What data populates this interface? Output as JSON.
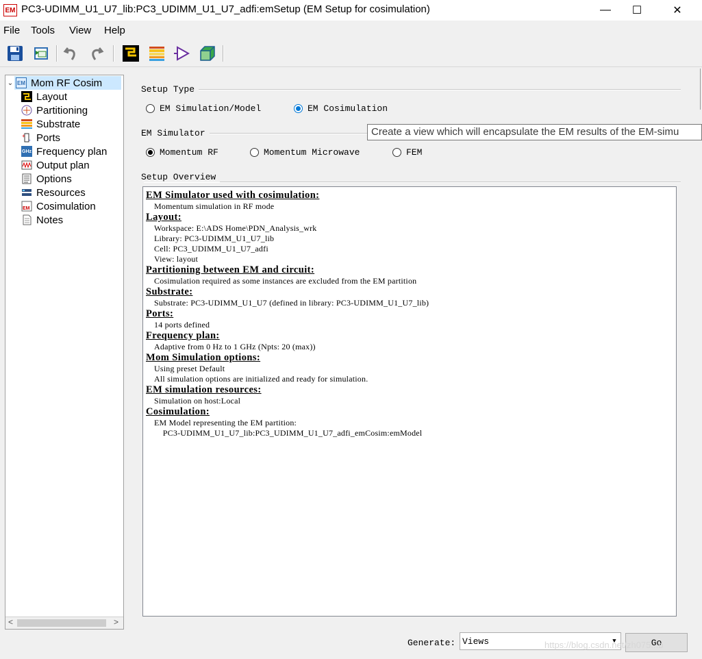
{
  "window": {
    "app_icon_text": "EM",
    "title": "PC3-UDIMM_U1_U7_lib:PC3_UDIMM_U1_U7_adfi:emSetup (EM Setup for cosimulation)",
    "minimize": "—",
    "maximize": "☐",
    "close": "✕"
  },
  "menu": [
    "File",
    "Tools",
    "View",
    "Help"
  ],
  "toolbar": {
    "buttons": [
      "save-icon",
      "em-import-icon",
      "undo-icon",
      "redo-icon",
      "layout-icon",
      "substrate-icon",
      "simulate-icon",
      "3d-view-icon"
    ]
  },
  "tree": {
    "root": "Mom RF Cosim",
    "root_icon_text": "EM",
    "items": [
      {
        "label": "Layout",
        "icon": "layout-icon"
      },
      {
        "label": "Partitioning",
        "icon": "partitioning-icon"
      },
      {
        "label": "Substrate",
        "icon": "substrate-icon"
      },
      {
        "label": "Ports",
        "icon": "ports-icon"
      },
      {
        "label": "Frequency plan",
        "icon": "frequency-icon"
      },
      {
        "label": "Output plan",
        "icon": "output-icon"
      },
      {
        "label": "Options",
        "icon": "options-icon"
      },
      {
        "label": "Resources",
        "icon": "resources-icon"
      },
      {
        "label": "Cosimulation",
        "icon": "cosimulation-icon"
      },
      {
        "label": "Notes",
        "icon": "notes-icon"
      }
    ],
    "ghz_text": "GHz"
  },
  "setup_type": {
    "label": "Setup Type",
    "options": [
      "EM Simulation/Model",
      "EM Cosimulation"
    ],
    "selected": "EM Cosimulation"
  },
  "em_simulator": {
    "label": "EM Simulator",
    "options": [
      "Momentum RF",
      "Momentum Microwave",
      "FEM"
    ],
    "selected": "Momentum RF"
  },
  "tooltip": "Create a view which will encapsulate the EM results of the EM-simu",
  "overview": {
    "label": "Setup Overview",
    "sections": [
      {
        "heading": "EM Simulator used with cosimulation:",
        "lines": [
          "Momentum simulation in RF mode"
        ]
      },
      {
        "heading": "Layout:",
        "lines": [
          "Workspace: E:\\ADS Home\\PDN_Analysis_wrk",
          "Library: PC3-UDIMM_U1_U7_lib",
          "Cell: PC3_UDIMM_U1_U7_adfi",
          "View: layout"
        ]
      },
      {
        "heading": "Partitioning between EM and circuit:",
        "lines": [
          "Cosimulation required as some instances are excluded from the EM partition"
        ]
      },
      {
        "heading": "Substrate:",
        "lines": [
          "Substrate: PC3-UDIMM_U1_U7 (defined in library: PC3-UDIMM_U1_U7_lib)"
        ]
      },
      {
        "heading": "Ports:",
        "lines": [
          "14 ports defined"
        ]
      },
      {
        "heading": "Frequency plan:",
        "lines": [
          "Adaptive from 0 Hz to 1 GHz (Npts: 20 (max))"
        ]
      },
      {
        "heading": "Mom Simulation options:",
        "lines": [
          "Using preset Default",
          "All simulation options are initialized and ready for simulation."
        ]
      },
      {
        "heading": "EM simulation resources:",
        "lines": [
          "Simulation on host:Local"
        ]
      },
      {
        "heading": "Cosimulation:",
        "lines": [
          "EM Model representing the EM partition:",
          "    PC3-UDIMM_U1_U7_lib:PC3_UDIMM_U1_U7_adfi_emCosim:emModel"
        ]
      }
    ]
  },
  "generate": {
    "label": "Generate:",
    "value": "Views",
    "go": "Go"
  },
  "watermark": "https://blog.csdn.net/zh075...b",
  "colors": {
    "radio_selected": "#0078d7",
    "tree_selected_bg": "#cce8ff",
    "app_icon": "#cc0000"
  }
}
